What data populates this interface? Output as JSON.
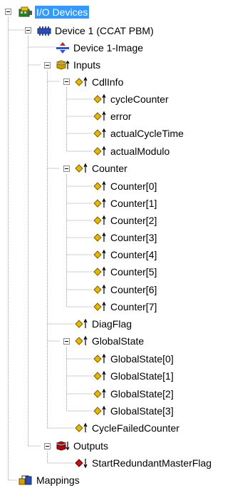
{
  "tree": {
    "root": "I/O Devices",
    "device": "Device 1 (CCAT PBM)",
    "image": "Device 1-Image",
    "inputs": "Inputs",
    "cdlinfo": "CdlInfo",
    "cdl_items": [
      "cycleCounter",
      "error",
      "actualCycleTime",
      "actualModulo"
    ],
    "counter": "Counter",
    "counter_items": [
      "Counter[0]",
      "Counter[1]",
      "Counter[2]",
      "Counter[3]",
      "Counter[4]",
      "Counter[5]",
      "Counter[6]",
      "Counter[7]"
    ],
    "diagflag": "DiagFlag",
    "globalstate": "GlobalState",
    "globalstate_items": [
      "GlobalState[0]",
      "GlobalState[1]",
      "GlobalState[2]",
      "GlobalState[3]"
    ],
    "cyclefailed": "CycleFailedCounter",
    "outputs": "Outputs",
    "output_item": "StartRedundantMasterFlag",
    "mappings": "Mappings"
  },
  "colors": {
    "selection": "#3399ff",
    "input_icon": "#e8b800",
    "output_icon": "#cc1111",
    "link_lines": "#a0a0a0"
  },
  "icons": {
    "root": "io-devices-icon",
    "device": "device-ccat-icon",
    "image": "process-image-icon",
    "input_var": "input-variable-icon",
    "output_var": "output-variable-icon",
    "mappings": "mappings-icon"
  }
}
